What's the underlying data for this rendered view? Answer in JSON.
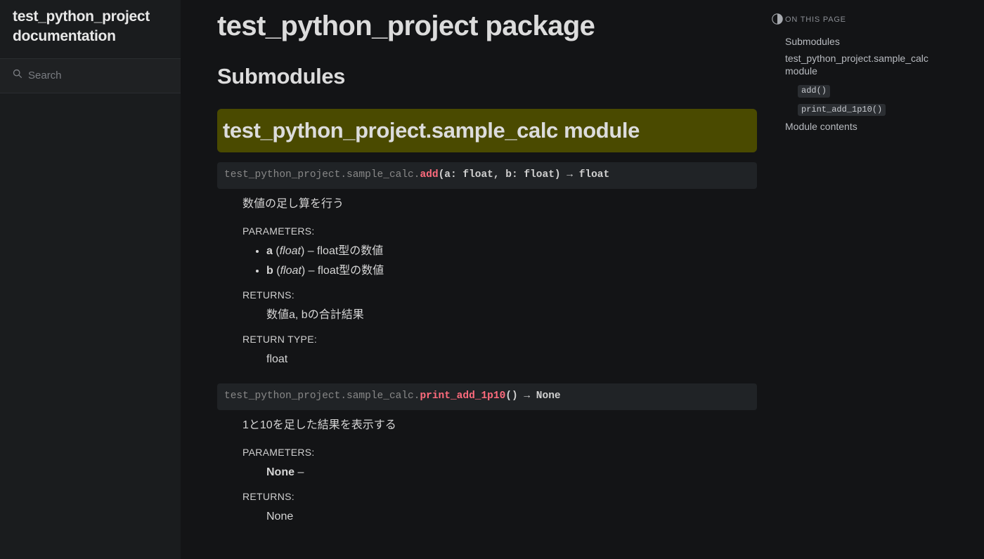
{
  "sidebar": {
    "title": "test_python_project documentation",
    "search_placeholder": "Search"
  },
  "page": {
    "h1": "test_python_project package",
    "h2_submodules": "Submodules",
    "h2_module": "test_python_project.sample_calc module"
  },
  "funcs": {
    "add": {
      "prefix": "test_python_project.sample_calc.",
      "name": "add",
      "args": "(a: float, b: float) → float",
      "desc": "数値の足し算を行う",
      "params_label": "PARAMETERS:",
      "param_a_name": "a",
      "param_a_type": "float",
      "param_a_desc": ") – float型の数値",
      "param_b_name": "b",
      "param_b_type": "float",
      "param_b_desc": ") – float型の数値",
      "returns_label": "RETURNS:",
      "returns_desc": "数値a, bの合計結果",
      "rtype_label": "RETURN TYPE:",
      "rtype_desc": "float"
    },
    "print": {
      "prefix": "test_python_project.sample_calc.",
      "name": "print_add_1p10",
      "args": "() → None",
      "desc": "1と10を足した結果を表示する",
      "params_label": "PARAMETERS:",
      "param_name": "None",
      "param_desc": " –",
      "returns_label": "RETURNS:",
      "returns_desc": "None"
    }
  },
  "toc": {
    "title": "On this page",
    "items": {
      "submodules": "Submodules",
      "module": "test_python_project.sample_calc module",
      "add": "add()",
      "print": "print_add_1p10()",
      "contents": "Module contents"
    }
  }
}
